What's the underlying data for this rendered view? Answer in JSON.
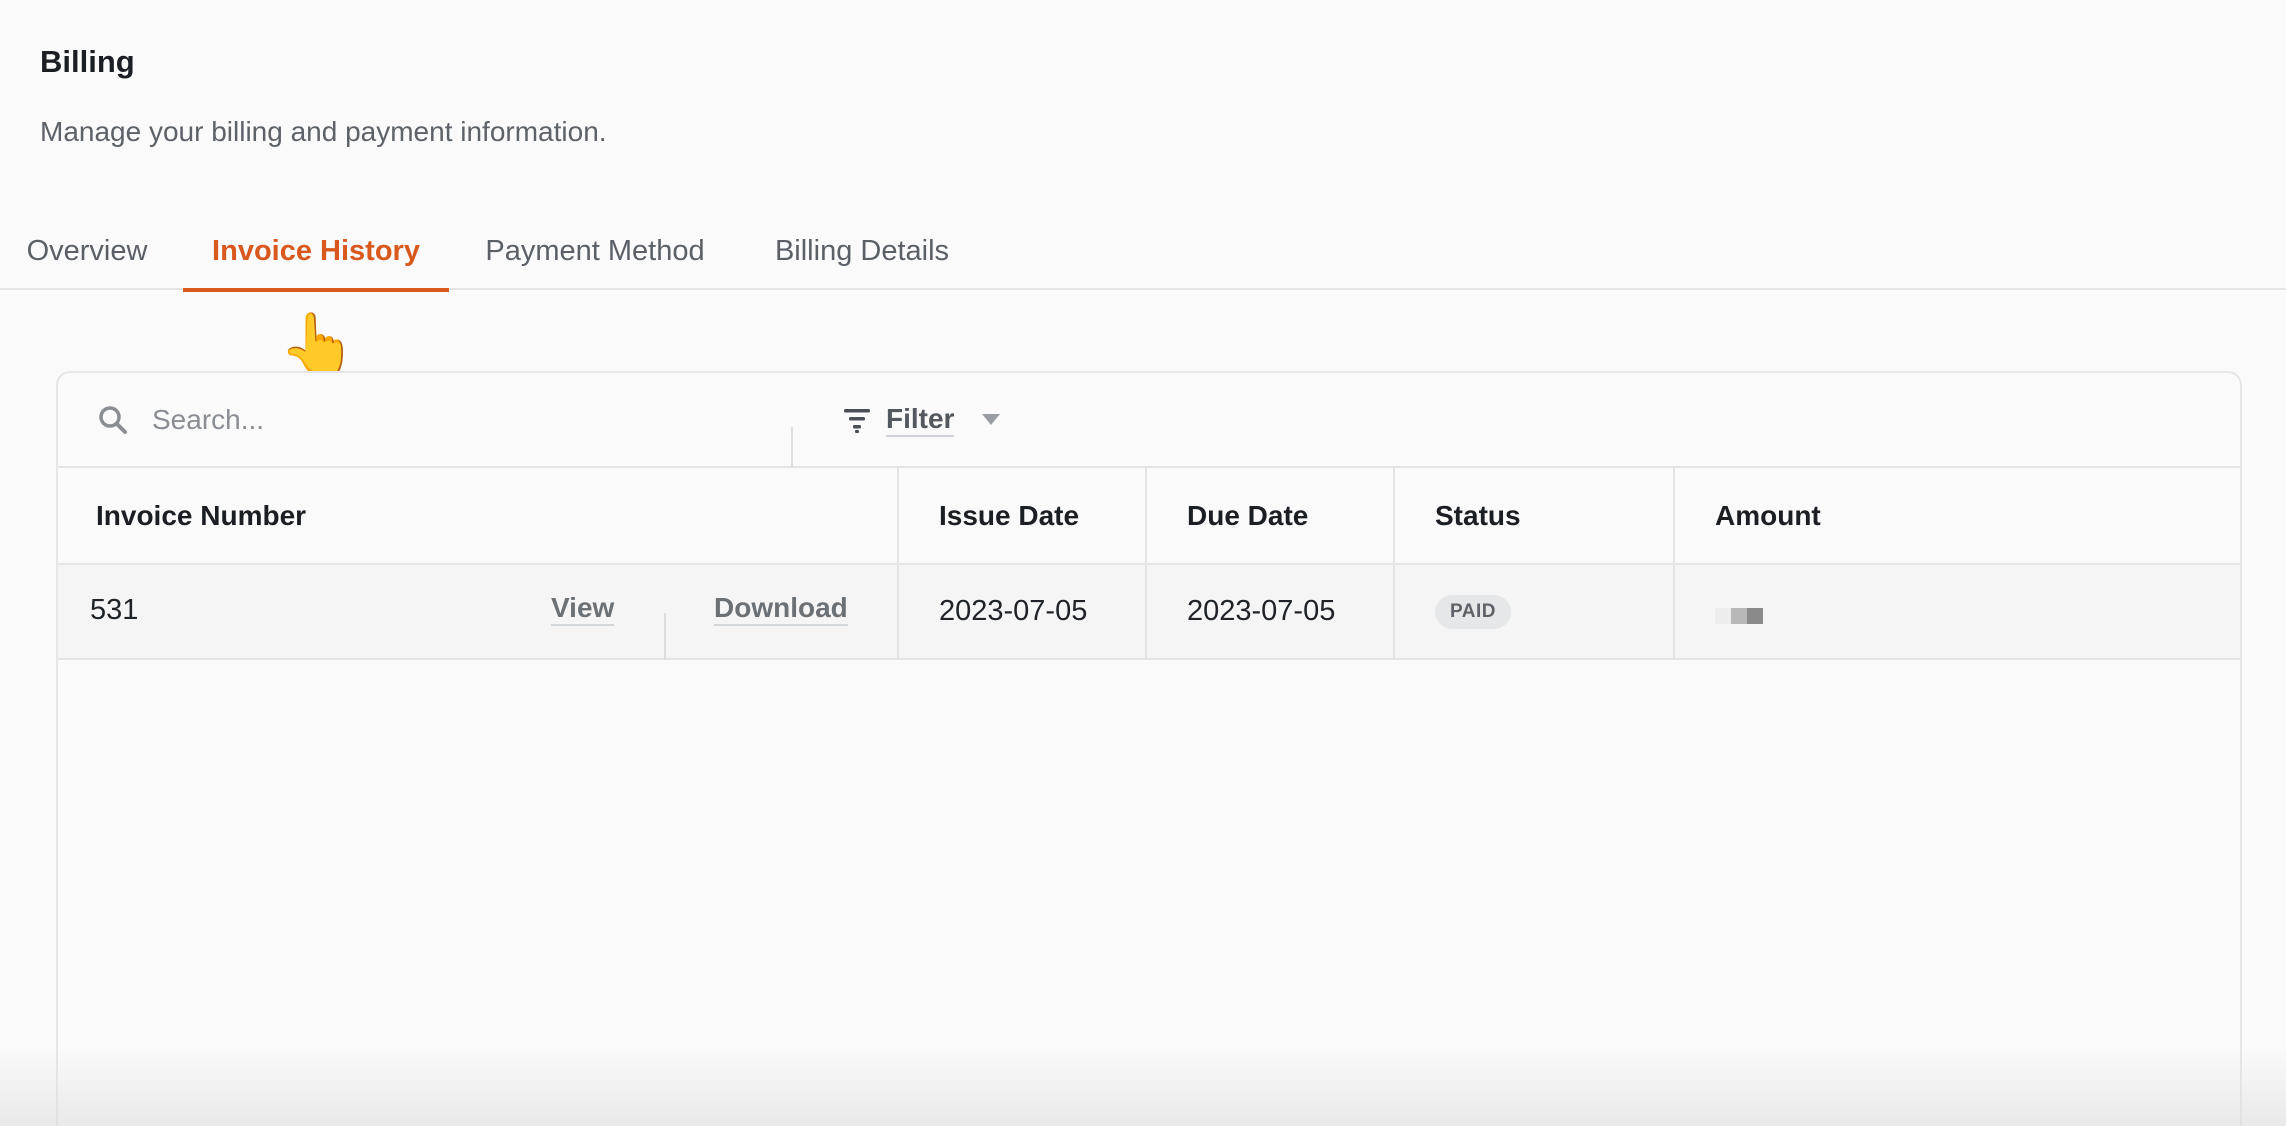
{
  "header": {
    "title": "Billing",
    "subtitle": "Manage your billing and payment information."
  },
  "tabs": [
    {
      "label": "Overview",
      "active": false
    },
    {
      "label": "Invoice History",
      "active": true
    },
    {
      "label": "Payment Method",
      "active": false
    },
    {
      "label": "Billing Details",
      "active": false
    }
  ],
  "toolbar": {
    "search_placeholder": "Search...",
    "search_value": "",
    "filter_label": "Filter"
  },
  "table": {
    "columns": [
      "Invoice Number",
      "Issue Date",
      "Due Date",
      "Status",
      "Amount"
    ],
    "rows": [
      {
        "invoice_number": "531",
        "view_label": "View",
        "download_label": "Download",
        "issue_date": "2023-07-05",
        "due_date": "2023-07-05",
        "status": "PAID",
        "amount": ""
      }
    ]
  },
  "cursor": "👆",
  "colors": {
    "accent": "#d9581e",
    "text": "#1f2328",
    "muted": "#5d6268",
    "border": "#e4e4e4",
    "badge_bg": "#e6e7e8"
  },
  "icons": {
    "search": "search-icon",
    "filter": "filter-icon",
    "caret": "chevron-down-icon"
  }
}
